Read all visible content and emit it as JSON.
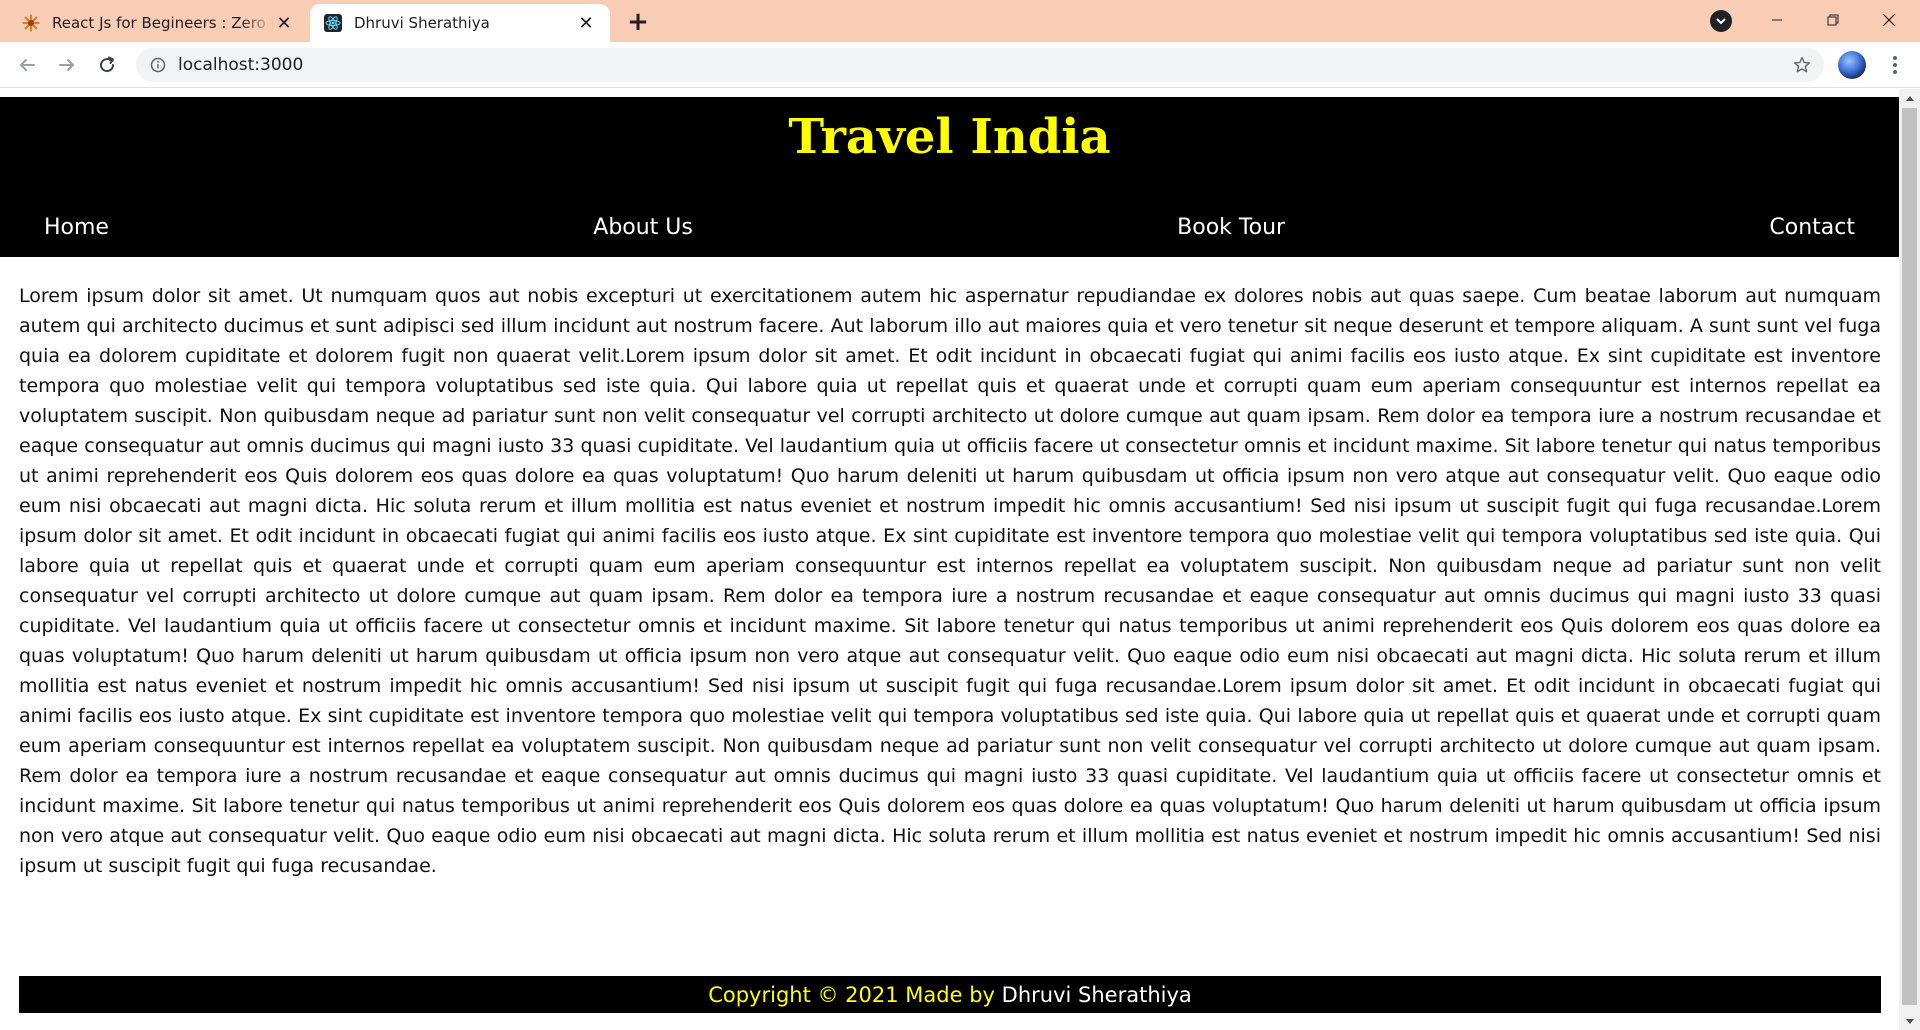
{
  "browser": {
    "tabs": [
      {
        "title": "React Js for Begineers : Zero to Hero",
        "favicon": "star-burst-icon",
        "active": false
      },
      {
        "title": "Dhruvi Sherathiya",
        "favicon": "react-logo-icon",
        "active": true
      }
    ],
    "new_tab_symbol": "+",
    "close_symbol": "✕",
    "url": "localhost:3000",
    "colors": {
      "tab_strip": "#f9ccb6",
      "active_tab": "#ffffff"
    }
  },
  "site": {
    "title": "Travel India",
    "nav": [
      "Home",
      "About Us",
      "Book Tour",
      "Contact"
    ],
    "body_text": "Lorem ipsum dolor sit amet. Ut numquam quos aut nobis excepturi ut exercitationem autem hic aspernatur repudiandae ex dolores nobis aut quas saepe. Cum beatae laborum aut numquam autem qui architecto ducimus et sunt adipisci sed illum incidunt aut nostrum facere. Aut laborum illo aut maiores quia et vero tenetur sit neque deserunt et tempore aliquam. A sunt sunt vel fuga quia ea dolorem cupiditate et dolorem fugit non quaerat velit.Lorem ipsum dolor sit amet. Et odit incidunt in obcaecati fugiat qui animi facilis eos iusto atque. Ex sint cupiditate est inventore tempora quo molestiae velit qui tempora voluptatibus sed iste quia. Qui labore quia ut repellat quis et quaerat unde et corrupti quam eum aperiam consequuntur est internos repellat ea voluptatem suscipit. Non quibusdam neque ad pariatur sunt non velit consequatur vel corrupti architecto ut dolore cumque aut quam ipsam. Rem dolor ea tempora iure a nostrum recusandae et eaque consequatur aut omnis ducimus qui magni iusto 33 quasi cupiditate. Vel laudantium quia ut officiis facere ut consectetur omnis et incidunt maxime. Sit labore tenetur qui natus temporibus ut animi reprehenderit eos Quis dolorem eos quas dolore ea quas voluptatum! Quo harum deleniti ut harum quibusdam ut officia ipsum non vero atque aut consequatur velit. Quo eaque odio eum nisi obcaecati aut magni dicta. Hic soluta rerum et illum mollitia est natus eveniet et nostrum impedit hic omnis accusantium! Sed nisi ipsum ut suscipit fugit qui fuga recusandae.Lorem ipsum dolor sit amet. Et odit incidunt in obcaecati fugiat qui animi facilis eos iusto atque. Ex sint cupiditate est inventore tempora quo molestiae velit qui tempora voluptatibus sed iste quia. Qui labore quia ut repellat quis et quaerat unde et corrupti quam eum aperiam consequuntur est internos repellat ea voluptatem suscipit. Non quibusdam neque ad pariatur sunt non velit consequatur vel corrupti architecto ut dolore cumque aut quam ipsam. Rem dolor ea tempora iure a nostrum recusandae et eaque consequatur aut omnis ducimus qui magni iusto 33 quasi cupiditate. Vel laudantium quia ut officiis facere ut consectetur omnis et incidunt maxime. Sit labore tenetur qui natus temporibus ut animi reprehenderit eos Quis dolorem eos quas dolore ea quas voluptatum! Quo harum deleniti ut harum quibusdam ut officia ipsum non vero atque aut consequatur velit. Quo eaque odio eum nisi obcaecati aut magni dicta. Hic soluta rerum et illum mollitia est natus eveniet et nostrum impedit hic omnis accusantium! Sed nisi ipsum ut suscipit fugit qui fuga recusandae.Lorem ipsum dolor sit amet. Et odit incidunt in obcaecati fugiat qui animi facilis eos iusto atque. Ex sint cupiditate est inventore tempora quo molestiae velit qui tempora voluptatibus sed iste quia. Qui labore quia ut repellat quis et quaerat unde et corrupti quam eum aperiam consequuntur est internos repellat ea voluptatem suscipit. Non quibusdam neque ad pariatur sunt non velit consequatur vel corrupti architecto ut dolore cumque aut quam ipsam. Rem dolor ea tempora iure a nostrum recusandae et eaque consequatur aut omnis ducimus qui magni iusto 33 quasi cupiditate. Vel laudantium quia ut officiis facere ut consectetur omnis et incidunt maxime. Sit labore tenetur qui natus temporibus ut animi reprehenderit eos Quis dolorem eos quas dolore ea quas voluptatum! Quo harum deleniti ut harum quibusdam ut officia ipsum non vero atque aut consequatur velit. Quo eaque odio eum nisi obcaecati aut magni dicta. Hic soluta rerum et illum mollitia est natus eveniet et nostrum impedit hic omnis accusantium! Sed nisi ipsum ut suscipit fugit qui fuga recusandae.",
    "footer": {
      "prefix": "Copyright © 2021 Made by ",
      "author": "Dhruvi Sherathiya"
    },
    "colors": {
      "header_bg": "#000000",
      "title": "#ffff00",
      "nav_text": "#ffffff",
      "footer_prefix": "#ffff00",
      "footer_author": "#ffffff"
    }
  }
}
